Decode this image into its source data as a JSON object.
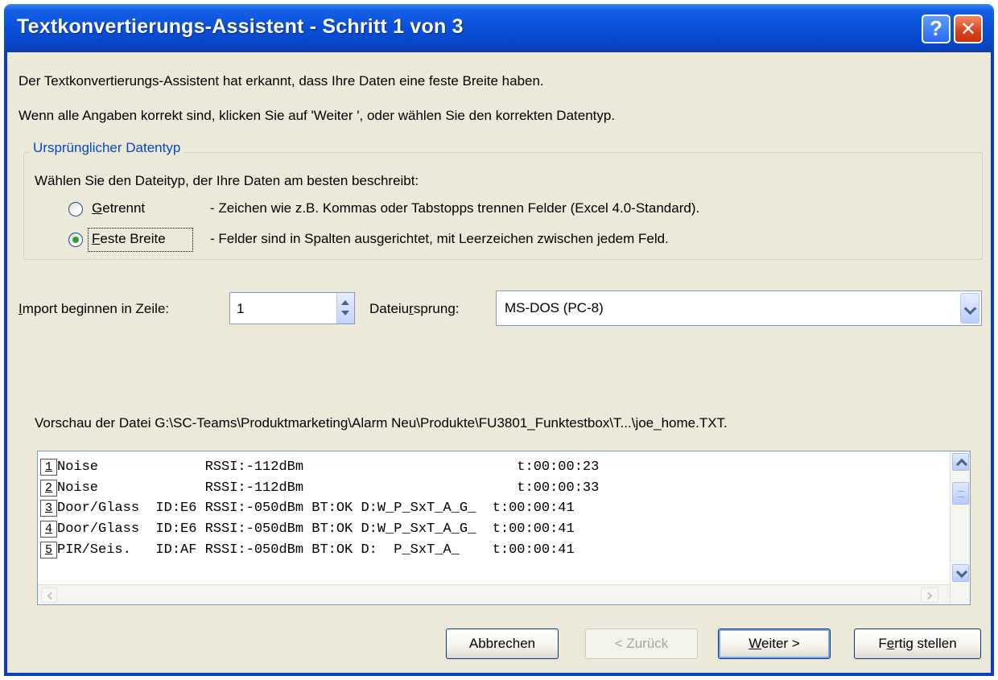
{
  "window": {
    "title": "Textkonvertierungs-Assistent - Schritt 1 von 3",
    "help_symbol": "?",
    "close_symbol": "✕"
  },
  "intro": {
    "line1": "Der Textkonvertierungs-Assistent hat erkannt, dass Ihre Daten eine feste Breite haben.",
    "line2": "Wenn alle Angaben korrekt sind, klicken Sie auf 'Weiter ', oder wählen Sie den korrekten Datentyp."
  },
  "datatype_group": {
    "legend": "Ursprünglicher Datentyp",
    "prompt": "Wählen Sie den Dateityp, der Ihre Daten am besten beschreibt:",
    "options": [
      {
        "key": "G",
        "rest": "etrennt",
        "description": "- Zeichen wie z.B. Kommas oder Tabstopps trennen Felder (Excel 4.0-Standard).",
        "selected": false
      },
      {
        "key": "F",
        "rest": "este Breite",
        "description": "- Felder sind in Spalten ausgerichtet, mit Leerzeichen zwischen jedem Feld.",
        "selected": true
      }
    ]
  },
  "import_row": {
    "label_key": "I",
    "label_rest": "mport beginnen in Zeile:",
    "value": "1",
    "origin_pre": "Dateiu",
    "origin_key": "r",
    "origin_rest": "sprung:",
    "origin_value": "MS-DOS (PC-8)"
  },
  "preview": {
    "label": "Vorschau der Datei G:\\SC-Teams\\Produktmarketing\\Alarm Neu\\Produkte\\FU3801_Funktestbox\\T...\\joe_home.TXT.",
    "rows": [
      {
        "num": "1",
        "text": "Noise             RSSI:-112dBm                          t:00:00:23"
      },
      {
        "num": "2",
        "text": "Noise             RSSI:-112dBm                          t:00:00:33"
      },
      {
        "num": "3",
        "text": "Door/Glass  ID:E6 RSSI:-050dBm BT:OK D:W_P_SxT_A_G_  t:00:00:41"
      },
      {
        "num": "4",
        "text": "Door/Glass  ID:E6 RSSI:-050dBm BT:OK D:W_P_SxT_A_G_  t:00:00:41"
      },
      {
        "num": "5",
        "text": "PIR/Seis.   ID:AF RSSI:-050dBm BT:OK D:  P_SxT_A_    t:00:00:41"
      }
    ]
  },
  "buttons": {
    "cancel": "Abbrechen",
    "back": "< Zurück",
    "next_key": "W",
    "next_rest": "eiter >",
    "finish_pre": "F",
    "finish_key": "e",
    "finish_rest": "rtig stellen"
  },
  "colors": {
    "title_bar": "#0a4fd8",
    "client_bg": "#ece9d8",
    "group_legend": "#0046d5",
    "radio_selected": "#2fa02f"
  }
}
